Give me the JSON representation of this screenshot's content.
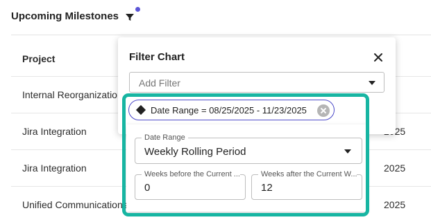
{
  "header": {
    "title": "Upcoming Milestones"
  },
  "table": {
    "column_header": "Project",
    "rows": [
      {
        "project": "Internal Reorganization",
        "right": ""
      },
      {
        "project": "Jira Integration",
        "right": "2025"
      },
      {
        "project": "Jira Integration",
        "right": "2025"
      },
      {
        "project": "Unified Communications",
        "right": "2025"
      }
    ]
  },
  "filter_panel": {
    "title": "Filter Chart",
    "add_filter_placeholder": "Add Filter",
    "chip_label": "Date Range = 08/25/2025 - 11/23/2025",
    "date_range": {
      "label": "Date Range",
      "value": "Weekly Rolling Period"
    },
    "weeks_before": {
      "label": "Weeks before the Current ...",
      "value": "0"
    },
    "weeks_after": {
      "label": "Weeks after the Current W...",
      "value": "12"
    }
  },
  "colors": {
    "highlight": "#17b5a2",
    "chip_border": "#4a48c8",
    "notification_dot": "#5b55d6"
  },
  "icons": [
    "filter-icon",
    "notification-dot",
    "close-icon",
    "diamond-icon",
    "chip-remove-icon",
    "caret-down-icon"
  ]
}
